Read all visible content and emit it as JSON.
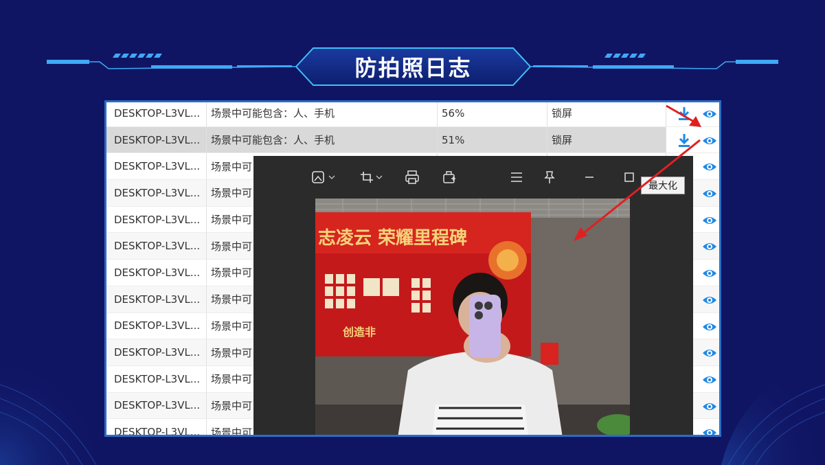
{
  "header": {
    "title": "防拍照日志"
  },
  "table": {
    "rows": [
      {
        "host": "DESKTOP-L3VL...",
        "scene": "场景中可能包含：人、手机",
        "confidence": "56%",
        "action": "锁屏"
      },
      {
        "host": "DESKTOP-L3VL...",
        "scene": "场景中可能包含：人、手机",
        "confidence": "51%",
        "action": "锁屏"
      },
      {
        "host": "DESKTOP-L3VL...",
        "scene": "场景中可"
      },
      {
        "host": "DESKTOP-L3VL...",
        "scene": "场景中可"
      },
      {
        "host": "DESKTOP-L3VL...",
        "scene": "场景中可"
      },
      {
        "host": "DESKTOP-L3VL...",
        "scene": "场景中可"
      },
      {
        "host": "DESKTOP-L3VL...",
        "scene": "场景中可"
      },
      {
        "host": "DESKTOP-L3VL...",
        "scene": "场景中可"
      },
      {
        "host": "DESKTOP-L3VL...",
        "scene": "场景中可"
      },
      {
        "host": "DESKTOP-L3VL...",
        "scene": "场景中可"
      },
      {
        "host": "DESKTOP-L3VL...",
        "scene": "场景中可"
      },
      {
        "host": "DESKTOP-L3VL...",
        "scene": "场景中可"
      },
      {
        "host": "DESKTOP-L3VL...",
        "scene": "场景中可"
      }
    ]
  },
  "viewer": {
    "tooltip": "最大化",
    "photo_banner": "志凌云 荣耀里程碑",
    "photo_footer": "创造非"
  },
  "colors": {
    "background": "#101563",
    "accent": "#3fa9f5",
    "frame_border": "#2d6cc6",
    "icon_blue": "#1e88e5",
    "arrow_red": "#e02020"
  }
}
